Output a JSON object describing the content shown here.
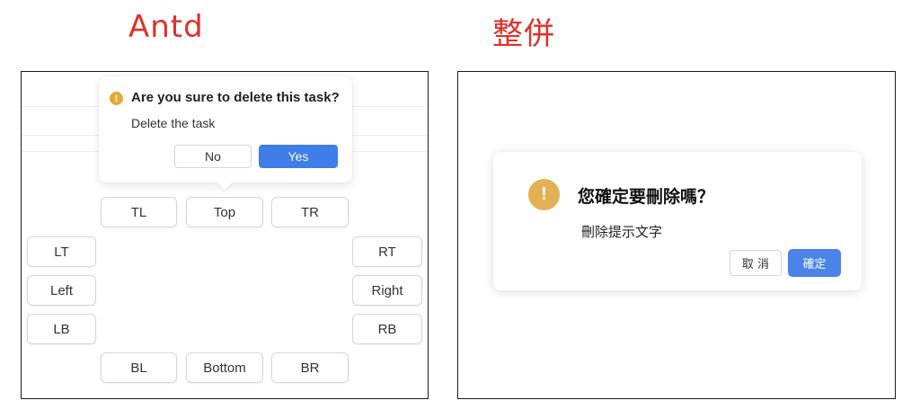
{
  "headings": {
    "left": "Antd",
    "right": "整併"
  },
  "antd": {
    "popconfirm": {
      "title": "Are you sure to delete this task?",
      "description": "Delete the task",
      "no_label": "No",
      "yes_label": "Yes",
      "icon": "exclamation-circle-icon",
      "icon_color": "#e5a836"
    },
    "placement_buttons": {
      "tl": "TL",
      "top": "Top",
      "tr": "TR",
      "lt": "LT",
      "left": "Left",
      "lb": "LB",
      "rt": "RT",
      "right": "Right",
      "rb": "RB",
      "bl": "BL",
      "bottom": "Bottom",
      "br": "BR"
    },
    "primary_color": "#3f7de8"
  },
  "merged": {
    "dialog": {
      "title": "您確定要刪除嗎？",
      "description": "刪除提示文字",
      "cancel_label": "取 消",
      "ok_label": "確定",
      "icon": "exclamation-circle-icon",
      "icon_color": "#e4b054"
    },
    "primary_color": "#4b84e8"
  },
  "heading_color": "#e0302a"
}
